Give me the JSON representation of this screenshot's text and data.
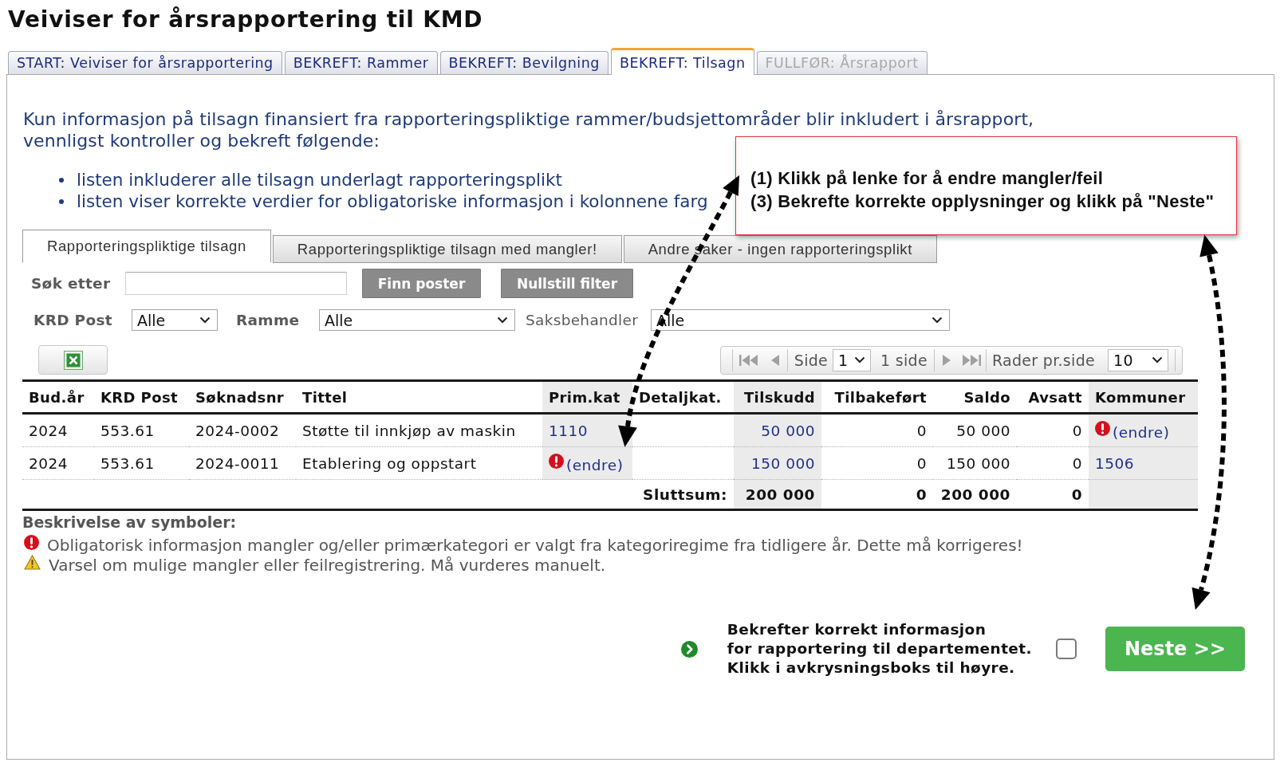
{
  "page_title": "Veiviser for årsrapportering til KMD",
  "wizard_tabs": [
    {
      "label": "START: Veiviser for årsrapportering",
      "selected": false,
      "disabled": false
    },
    {
      "label": "BEKREFT: Rammer",
      "selected": false,
      "disabled": false
    },
    {
      "label": "BEKREFT: Bevilgning",
      "selected": false,
      "disabled": false
    },
    {
      "label": "BEKREFT: Tilsagn",
      "selected": true,
      "disabled": false
    },
    {
      "label": "FULLFØR: Årsrapport",
      "selected": false,
      "disabled": true
    }
  ],
  "intro": {
    "text": "Kun informasjon på tilsagn finansiert fra rapporteringspliktige rammer/budsjettområder blir inkludert i årsrapport, vennligst kontroller og bekreft følgende:",
    "bullets": [
      "listen inkluderer alle tilsagn underlagt rapporteringsplikt",
      "listen viser korrekte verdier for obligatoriske informasjon i kolonnene farg"
    ]
  },
  "callout": {
    "lines": [
      "(1) Klikk på lenke for å endre mangler/feil",
      "(3) Bekrefte korrekte opplysninger og klikk på \"Neste\""
    ]
  },
  "subtabs": [
    {
      "label": "Rapporteringspliktige tilsagn",
      "selected": true
    },
    {
      "label": "Rapporteringspliktige tilsagn med mangler!",
      "selected": false
    },
    {
      "label": "Andre saker - ingen rapporteringsplikt",
      "selected": false
    }
  ],
  "search": {
    "label": "Søk etter",
    "buttons": [
      "Finn poster",
      "Nullstill filter"
    ]
  },
  "filters": [
    {
      "label": "KRD Post",
      "value": "Alle"
    },
    {
      "label": "Ramme",
      "value": "Alle"
    },
    {
      "label": "Saksbehandler",
      "value": "Alle"
    }
  ],
  "pager": {
    "page_label": "Side",
    "page": "1",
    "page_count": "1 side",
    "rows_label": "Rader pr.side",
    "rows_per_page": "10"
  },
  "table": {
    "columns": [
      {
        "label": "Bud.år",
        "required": false
      },
      {
        "label": "KRD Post",
        "required": false
      },
      {
        "label": "Søknadsnr",
        "required": false
      },
      {
        "label": "Tittel",
        "required": false
      },
      {
        "label": "Prim.kat",
        "required": true
      },
      {
        "label": "Detaljkat.",
        "required": false
      },
      {
        "label": "Tilskudd",
        "required": true
      },
      {
        "label": "Tilbakeført",
        "required": false
      },
      {
        "label": "Saldo",
        "required": false
      },
      {
        "label": "Avsatt",
        "required": false
      },
      {
        "label": "Kommuner",
        "required": true
      }
    ],
    "rows": [
      {
        "cells": [
          {
            "kind": "plain",
            "text": "2024"
          },
          {
            "kind": "plain",
            "text": "553.61"
          },
          {
            "kind": "plain",
            "text": "2024-0002"
          },
          {
            "kind": "plain",
            "text": "Støtte til innkjøp av maskin"
          },
          {
            "kind": "link",
            "text": "1110"
          },
          null,
          {
            "kind": "link",
            "text": "50 000"
          },
          {
            "kind": "plain",
            "text": "0"
          },
          {
            "kind": "plain",
            "text": "50 000"
          },
          {
            "kind": "plain",
            "text": "0"
          },
          {
            "kind": "missing",
            "text": "(endre)"
          }
        ]
      },
      {
        "cells": [
          {
            "kind": "plain",
            "text": "2024"
          },
          {
            "kind": "plain",
            "text": "553.61"
          },
          {
            "kind": "plain",
            "text": "2024-0011"
          },
          {
            "kind": "plain",
            "text": "Etablering og oppstart"
          },
          {
            "kind": "missing",
            "text": "(endre)"
          },
          null,
          {
            "kind": "link",
            "text": "150 000"
          },
          {
            "kind": "plain",
            "text": "0"
          },
          {
            "kind": "plain",
            "text": "150 000"
          },
          {
            "kind": "plain",
            "text": "0"
          },
          {
            "kind": "link",
            "text": "1506"
          }
        ]
      }
    ],
    "total": {
      "label": "Sluttsum:",
      "values": [
        "200 000",
        "0",
        "200 000",
        "0"
      ]
    }
  },
  "legend": {
    "title": "Beskrivelse av symboler:",
    "items": [
      {
        "kind": "error",
        "text": "Obligatorisk informasjon mangler og/eller primærkategori er valgt fra kategoriregime fra tidligere år. Dette må korrigeres!"
      },
      {
        "kind": "warning",
        "text": "Varsel om mulige mangler eller feilregistrering. Må vurderes manuelt."
      }
    ]
  },
  "confirm": {
    "text": "Bekrefter korrekt informasjon\nfor rapportering til departementet.\nKlikk i avkrysningsboks til høyre.",
    "checked": false,
    "button": "Neste >>"
  }
}
